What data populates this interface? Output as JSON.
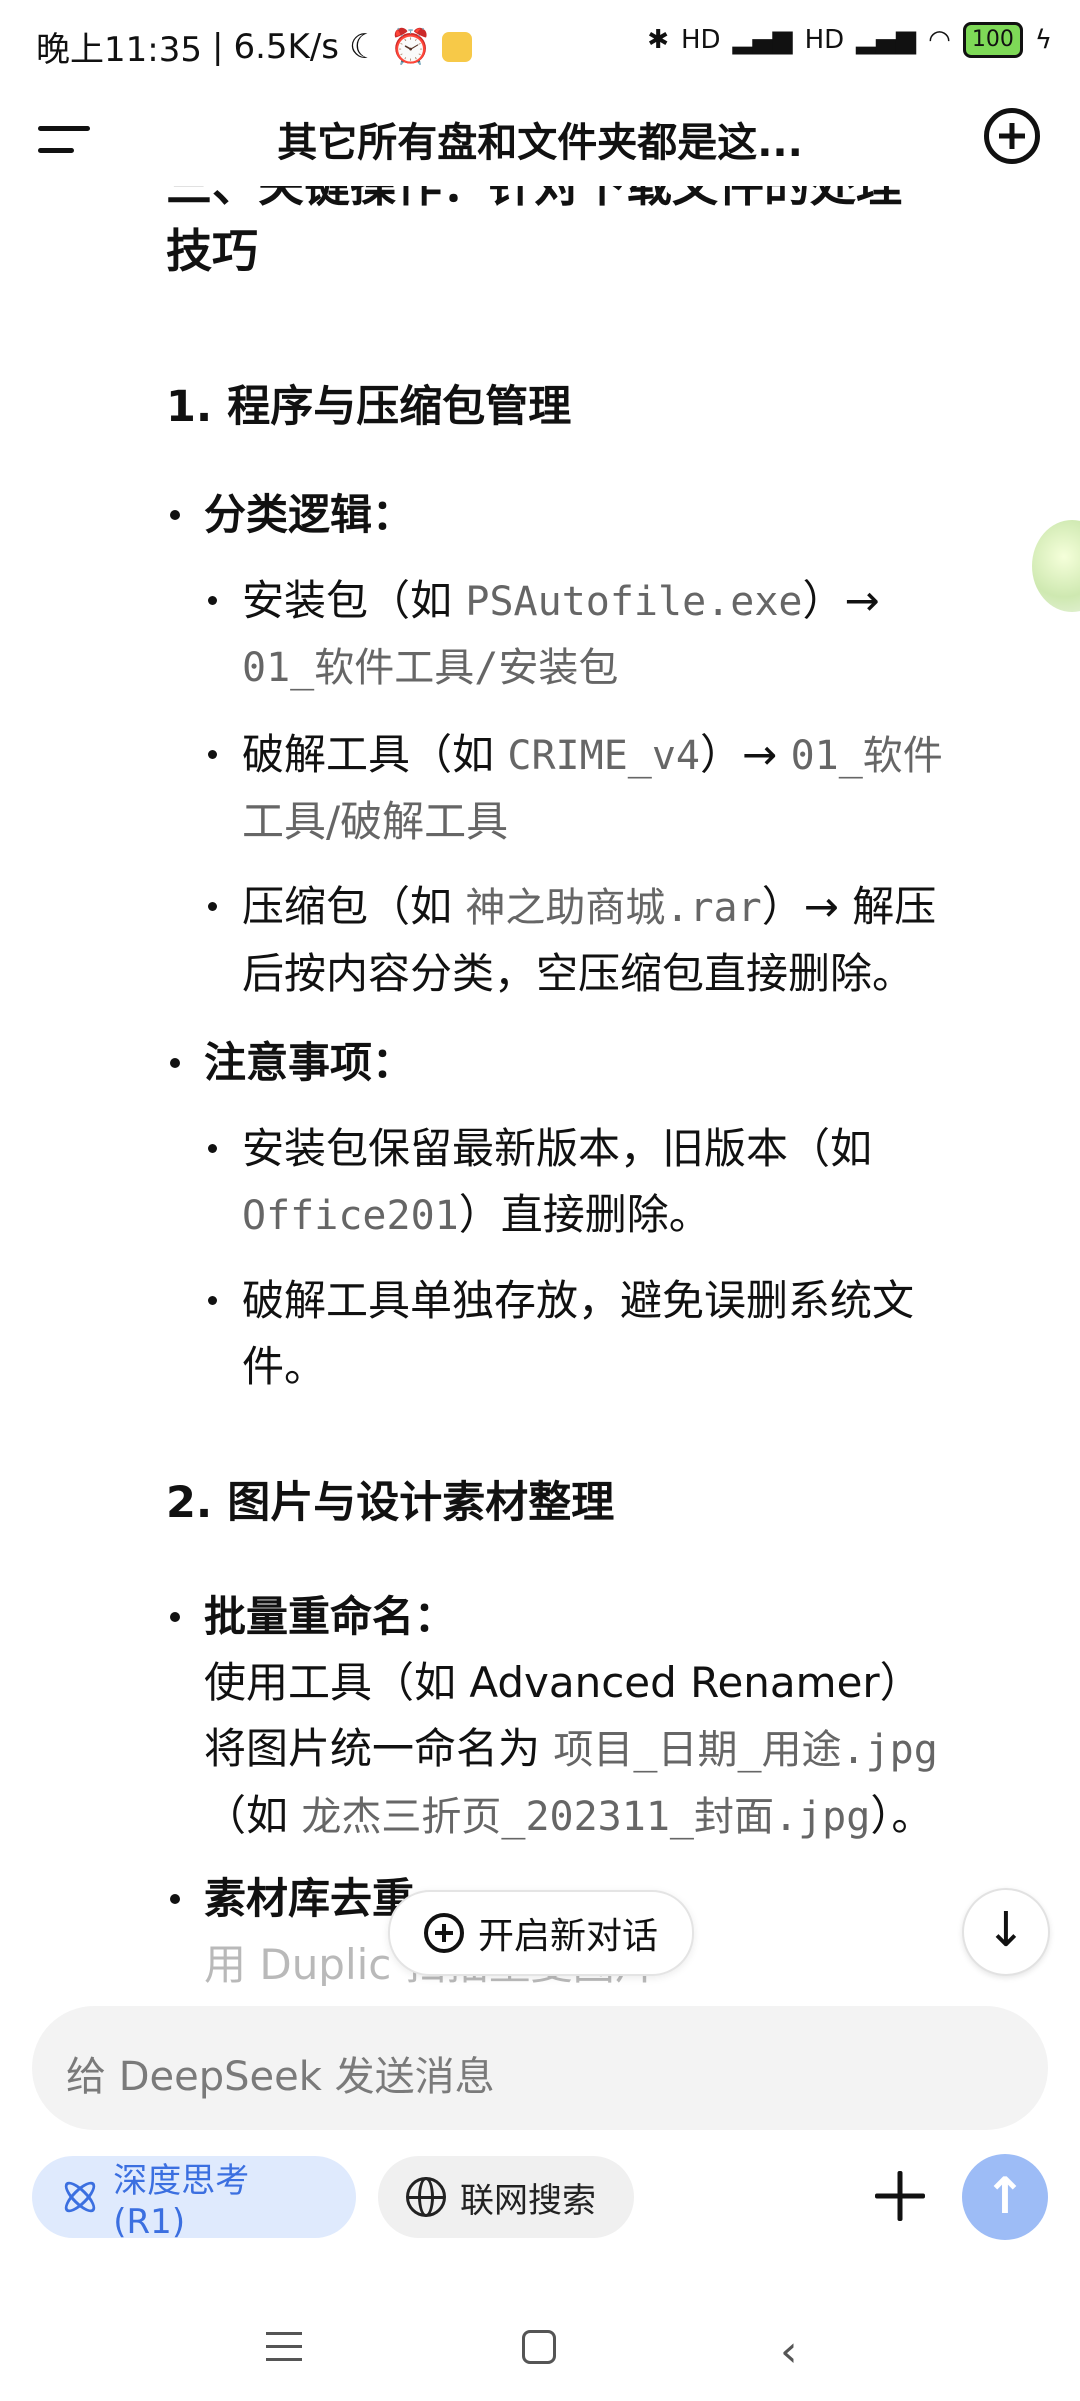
{
  "status": {
    "time": "晚上11:35",
    "speed": "6.5K/s",
    "signal_hd1": "HD",
    "signal_hd2": "HD",
    "battery": "100"
  },
  "header": {
    "title": "其它所有盘和文件夹都是这..."
  },
  "content": {
    "section_title_line1": "三、关键操作：针对下载文件的处理",
    "section_title_line2": "技巧",
    "sub1_title": "1. 程序与压缩包管理",
    "b1_label": "分类逻辑：",
    "b1_1_pre": "安装包（如 ",
    "b1_1_code": "PSAutofile.exe",
    "b1_1_post": "）→",
    "b1_1_line2": "01_软件工具/安装包",
    "b1_2_pre": "破解工具（如 ",
    "b1_2_code": "CRIME_v4",
    "b1_2_mid": "）→ ",
    "b1_2_code2": "01_软件",
    "b1_2_line2": "工具/破解工具",
    "b1_3_pre": "压缩包（如 ",
    "b1_3_code": "神之助商城.rar",
    "b1_3_post": "）→ 解压",
    "b1_3_line2": "后按内容分类，空压缩包直接删除。",
    "b2_label": "注意事项：",
    "b2_1_line1": "安装包保留最新版本，旧版本（如",
    "b2_1_code": "Office201",
    "b2_1_post": "）直接删除。",
    "b2_2_line1": "破解工具单独存放，避免误删系统文",
    "b2_2_line2": "件。",
    "sub2_title": "2. 图片与设计素材整理",
    "b3_label": "批量重命名：",
    "b3_line2": "使用工具（如 Advanced Renamer）",
    "b3_line3_pre": "将图片统一命名为 ",
    "b3_line3_code": "项目_日期_用途.jpg",
    "b3_line4_pre": "（如 ",
    "b3_line4_code": "龙杰三折页_202311_封面.jpg",
    "b3_line4_post": "）。",
    "b4_label": "素材库去重",
    "b4_line2": "用 Duplic        扫描重复图片"
  },
  "floating": {
    "new_chat": "开启新对话",
    "scroll_down": "↓"
  },
  "input": {
    "placeholder": "给 DeepSeek 发送消息",
    "deep_think": "深度思考 (R1)",
    "web_search": "联网搜索",
    "send": "↑"
  },
  "nav": {
    "back": "‹"
  }
}
